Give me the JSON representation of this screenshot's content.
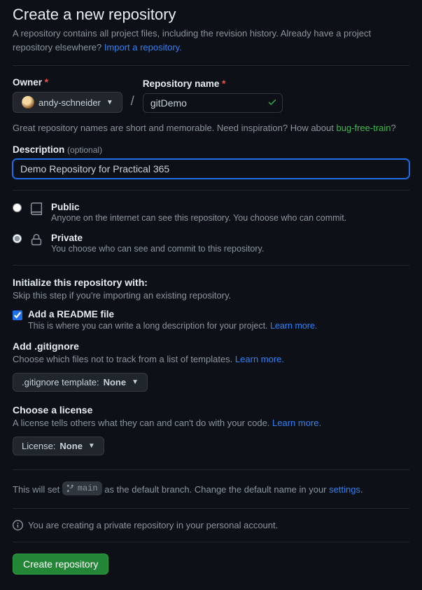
{
  "header": {
    "title": "Create a new repository",
    "subtext": "A repository contains all project files, including the revision history. Already have a project repository elsewhere?",
    "import_link": "Import a repository."
  },
  "owner": {
    "label": "Owner",
    "value": "andy-schneider"
  },
  "repo": {
    "label": "Repository name",
    "value": "gitDemo"
  },
  "name_hint": {
    "prefix": "Great repository names are short and memorable. Need inspiration? How about ",
    "suggestion": "bug-free-train",
    "suffix": "?"
  },
  "description": {
    "label": "Description",
    "optional": "(optional)",
    "value": "Demo Repository for Practical 365"
  },
  "visibility": {
    "public": {
      "title": "Public",
      "sub": "Anyone on the internet can see this repository. You choose who can commit."
    },
    "private": {
      "title": "Private",
      "sub": "You choose who can see and commit to this repository."
    }
  },
  "init": {
    "heading": "Initialize this repository with:",
    "skip": "Skip this step if you're importing an existing repository.",
    "readme": {
      "title": "Add a README file",
      "sub_prefix": "This is where you can write a long description for your project. ",
      "learn": "Learn more."
    },
    "gitignore": {
      "label": "Add .gitignore",
      "sub_prefix": "Choose which files not to track from a list of templates. ",
      "learn": "Learn more.",
      "button_prefix": ".gitignore template: ",
      "button_value": "None"
    },
    "license": {
      "label": "Choose a license",
      "sub_prefix": "A license tells others what they can and can't do with your code. ",
      "learn": "Learn more.",
      "button_prefix": "License: ",
      "button_value": "None"
    }
  },
  "branch": {
    "prefix": "This will set ",
    "name": "main",
    "mid": " as the default branch. Change the default name in your ",
    "link": "settings",
    "suffix": "."
  },
  "info_note": "You are creating a private repository in your personal account.",
  "submit": "Create repository"
}
